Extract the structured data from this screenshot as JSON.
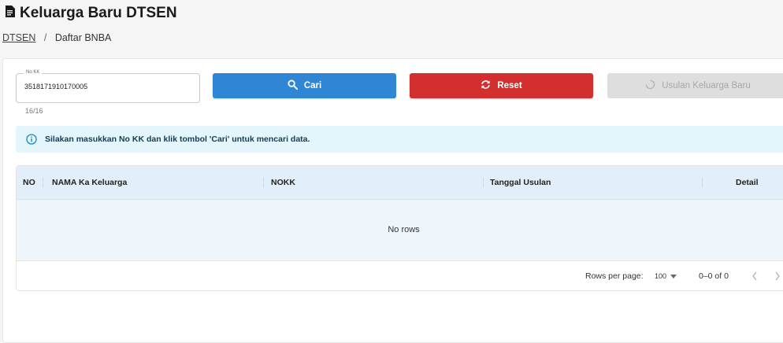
{
  "page": {
    "title": "Keluarga Baru DTSEN",
    "title_icon": "document-icon"
  },
  "breadcrumb": {
    "root": "DTSEN",
    "separator": "/",
    "current": "Daftar BNBA"
  },
  "search": {
    "label": "No KK",
    "value": "3518171910170005",
    "counter": "16/16"
  },
  "buttons": {
    "cari": "Cari",
    "reset": "Reset",
    "usulan": "Usulan Keluarga Baru"
  },
  "alert": {
    "message": "Silakan masukkan No KK dan klik tombol 'Cari' untuk mencari data."
  },
  "table": {
    "columns": [
      "NO",
      "NAMA Ka Keluarga",
      "NOKK",
      "Tanggal Usulan",
      "Detail"
    ],
    "empty_text": "No rows"
  },
  "pagination": {
    "rows_per_page_label": "Rows per page:",
    "rows_per_page_value": "100",
    "range": "0–0 of 0"
  },
  "colors": {
    "primary": "#2f86d4",
    "danger": "#d32f2f",
    "disabled": "#dedede",
    "info_bg": "#e5f5fc",
    "header_bg": "#e2eef9"
  }
}
